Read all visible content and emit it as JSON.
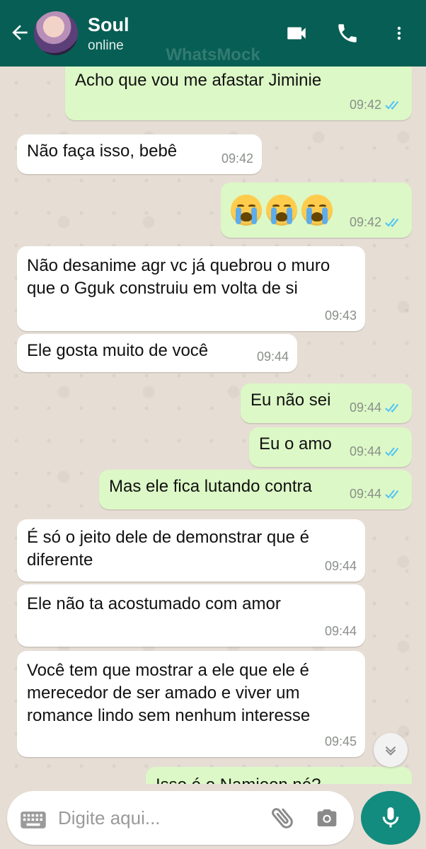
{
  "header": {
    "contact_name": "Soul",
    "status": "online",
    "watermark": "WhatsMock"
  },
  "messages": [
    {
      "dir": "out",
      "text": "Acho que vou me afastar Jiminie",
      "time": "09:42",
      "read": true
    },
    {
      "dir": "in",
      "text": "Não faça isso, bebê",
      "time": "09:42"
    },
    {
      "dir": "out",
      "emoji": "😭😭😭",
      "time": "09:42",
      "read": true
    },
    {
      "dir": "in",
      "text": "Não desanime agr vc já quebrou o muro que o Gguk construiu em volta de si",
      "time": "09:43"
    },
    {
      "dir": "in",
      "text": "Ele gosta muito de você",
      "time": "09:44"
    },
    {
      "dir": "out",
      "text": "Eu não sei",
      "time": "09:44",
      "read": true
    },
    {
      "dir": "out",
      "text": "Eu o amo",
      "time": "09:44",
      "read": true
    },
    {
      "dir": "out",
      "text": "Mas ele fica lutando contra",
      "time": "09:44",
      "read": true
    },
    {
      "dir": "in",
      "text": "É só o jeito dele de demonstrar que é diferente",
      "time": "09:44"
    },
    {
      "dir": "in",
      "text": "Ele não ta acostumado com amor",
      "time": "09:44"
    },
    {
      "dir": "in",
      "text": "Você tem que mostrar a ele que ele é merecedor de ser amado e viver um romance lindo sem nenhum interesse",
      "time": "09:45"
    },
    {
      "dir": "out",
      "text": "Isso é o Namjoon né?",
      "time": "",
      "read": true
    }
  ],
  "composer": {
    "placeholder": "Digite aqui..."
  },
  "icons": {
    "back": "arrow-left-icon",
    "video": "video-call-icon",
    "call": "phone-icon",
    "menu": "more-vert-icon",
    "keyboard": "keyboard-icon",
    "attach": "paperclip-icon",
    "camera": "camera-icon",
    "mic": "mic-icon",
    "scroll": "chevron-down-icon"
  },
  "colors": {
    "header": "#075e54",
    "outgoing_bubble": "#dcf8c6",
    "incoming_bubble": "#ffffff",
    "read_ticks": "#4fc3f7",
    "mic_button": "#128c7e"
  }
}
